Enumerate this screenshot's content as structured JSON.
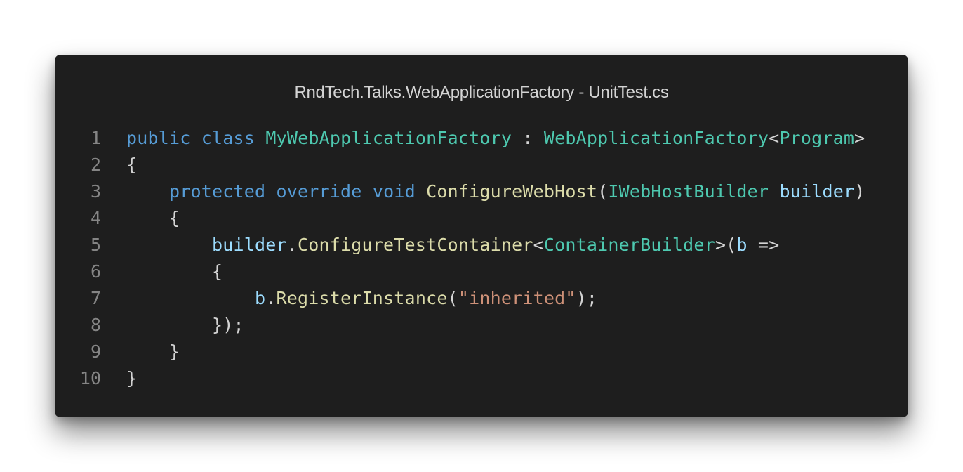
{
  "window": {
    "title": "RndTech.Talks.WebApplicationFactory - UnitTest.cs"
  },
  "colors": {
    "background": "#1e1e1e",
    "keyword": "#569cd6",
    "type": "#4ec9b0",
    "function": "#dcdcaa",
    "variable": "#9cdcfe",
    "string": "#ce9178",
    "text": "#d4d4d4",
    "line_number": "#858585"
  },
  "code": {
    "lines": [
      {
        "number": "1",
        "tokens": [
          {
            "text": "public",
            "kind": "kw"
          },
          {
            "text": " ",
            "kind": "punc"
          },
          {
            "text": "class",
            "kind": "kw"
          },
          {
            "text": " ",
            "kind": "punc"
          },
          {
            "text": "MyWebApplicationFactory",
            "kind": "type"
          },
          {
            "text": " : ",
            "kind": "punc"
          },
          {
            "text": "WebApplicationFactory",
            "kind": "type"
          },
          {
            "text": "<",
            "kind": "punc"
          },
          {
            "text": "Program",
            "kind": "type"
          },
          {
            "text": ">",
            "kind": "punc"
          }
        ]
      },
      {
        "number": "2",
        "tokens": [
          {
            "text": "{",
            "kind": "punc"
          }
        ]
      },
      {
        "number": "3",
        "tokens": [
          {
            "text": "    ",
            "kind": "punc"
          },
          {
            "text": "protected",
            "kind": "kw"
          },
          {
            "text": " ",
            "kind": "punc"
          },
          {
            "text": "override",
            "kind": "kw"
          },
          {
            "text": " ",
            "kind": "punc"
          },
          {
            "text": "void",
            "kind": "kw"
          },
          {
            "text": " ",
            "kind": "punc"
          },
          {
            "text": "ConfigureWebHost",
            "kind": "fn"
          },
          {
            "text": "(",
            "kind": "punc"
          },
          {
            "text": "IWebHostBuilder",
            "kind": "type"
          },
          {
            "text": " ",
            "kind": "punc"
          },
          {
            "text": "builder",
            "kind": "var"
          },
          {
            "text": ")",
            "kind": "punc"
          }
        ]
      },
      {
        "number": "4",
        "tokens": [
          {
            "text": "    {",
            "kind": "punc"
          }
        ]
      },
      {
        "number": "5",
        "tokens": [
          {
            "text": "        ",
            "kind": "punc"
          },
          {
            "text": "builder",
            "kind": "var"
          },
          {
            "text": ".",
            "kind": "punc"
          },
          {
            "text": "ConfigureTestContainer",
            "kind": "fn"
          },
          {
            "text": "<",
            "kind": "punc"
          },
          {
            "text": "ContainerBuilder",
            "kind": "type"
          },
          {
            "text": ">(",
            "kind": "punc"
          },
          {
            "text": "b",
            "kind": "var"
          },
          {
            "text": " =>",
            "kind": "punc"
          }
        ]
      },
      {
        "number": "6",
        "tokens": [
          {
            "text": "        {",
            "kind": "punc"
          }
        ]
      },
      {
        "number": "7",
        "tokens": [
          {
            "text": "            ",
            "kind": "punc"
          },
          {
            "text": "b",
            "kind": "var"
          },
          {
            "text": ".",
            "kind": "punc"
          },
          {
            "text": "RegisterInstance",
            "kind": "fn"
          },
          {
            "text": "(",
            "kind": "punc"
          },
          {
            "text": "\"inherited\"",
            "kind": "str"
          },
          {
            "text": ");",
            "kind": "punc"
          }
        ]
      },
      {
        "number": "8",
        "tokens": [
          {
            "text": "        });",
            "kind": "punc"
          }
        ]
      },
      {
        "number": "9",
        "tokens": [
          {
            "text": "    }",
            "kind": "punc"
          }
        ]
      },
      {
        "number": "10",
        "tokens": [
          {
            "text": "}",
            "kind": "punc"
          }
        ]
      }
    ]
  }
}
